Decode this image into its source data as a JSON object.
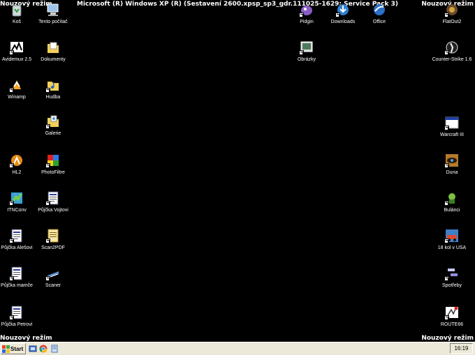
{
  "safe_mode_label": "Nouzový režim",
  "build_banner": "Microsoft (R) Windows XP (R) (Sestavení 2600.xpsp_sp3_gdr.111025-1629: Service Pack 3)",
  "icons": {
    "kos": "Koš",
    "tento_pocitac": "Tento počítač",
    "avidemux": "Avidemux 2.5",
    "dokumenty": "Dokumenty",
    "winamp": "Winamp",
    "hudba": "Hudba",
    "galerie": "Galerie",
    "hl2": "HL2",
    "photofiltre": "PhotoFiltre",
    "itnconv": "ITNConv",
    "pujcka_vojtovi": "Půjčka Vojtovi",
    "pujcka_alesovi": "Půjčka Alešovi",
    "scan2pdf": "Scan2PDF",
    "pujcka_mamce": "Půjčka mamče",
    "scaner": "Scaner",
    "pujcka_petrovi": "Půjčka Petrovi",
    "pidgin": "Pidgin",
    "downloads": "Downloads",
    "office": "Office",
    "obrazky": "Obrázky",
    "flatout2": "FlatOut2",
    "counter_strike": "Counter-Strike 1.6",
    "warcraft": "Warcraft III",
    "duna": "Duna",
    "bulanci": "Bulánci",
    "kol_usa": "18 kol v USA",
    "spotreby": "Spotřeby",
    "route66": "ROUTE66"
  },
  "taskbar": {
    "start_label": "Start",
    "clock": "16:19"
  }
}
